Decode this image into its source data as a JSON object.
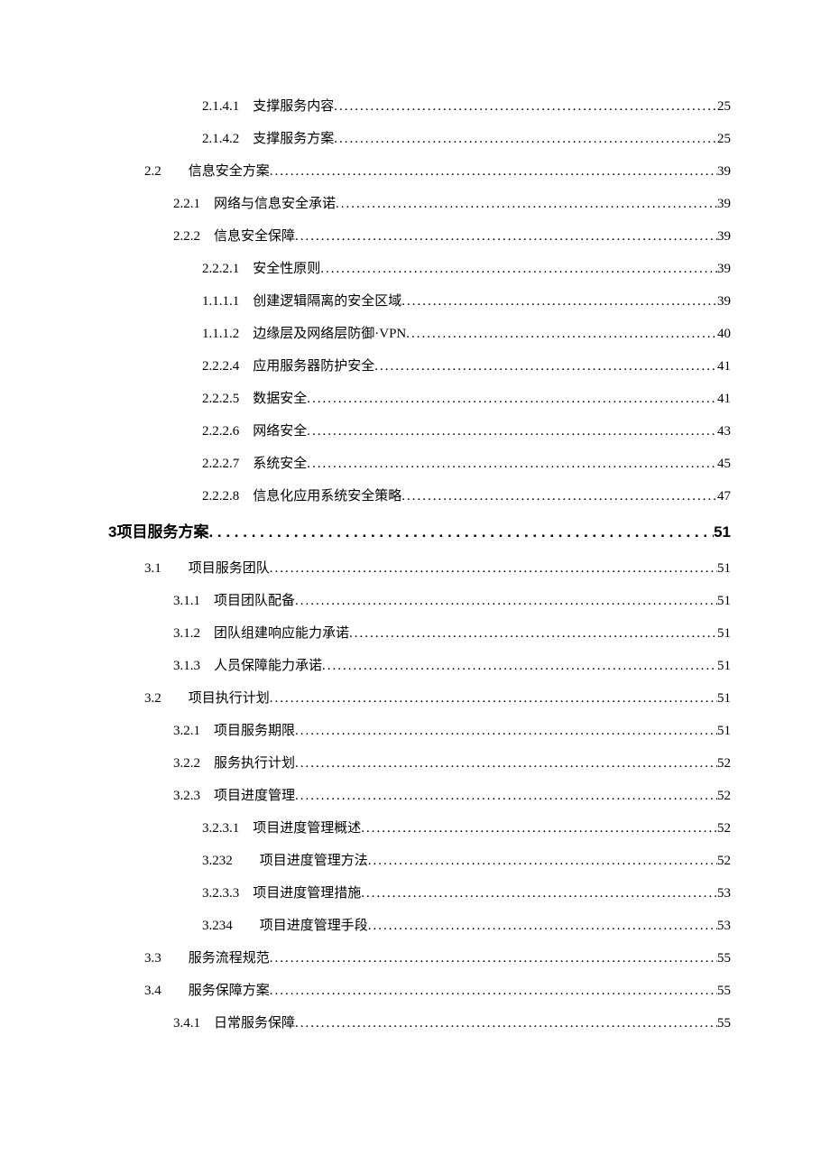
{
  "toc": [
    {
      "indent": 3,
      "num": "2.1.4.1",
      "gap": "　",
      "title": "支撑服务内容",
      "page": "25",
      "heading": false
    },
    {
      "indent": 3,
      "num": "2.1.4.2",
      "gap": "　",
      "title": "支撑服务方案",
      "page": "25",
      "heading": false
    },
    {
      "indent": 1,
      "num": "2.2",
      "gap": "　　",
      "title": "信息安全方案",
      "page": "39",
      "heading": false
    },
    {
      "indent": 2,
      "num": "2.2.1",
      "gap": "　",
      "title": "网络与信息安全承诺",
      "page": "39",
      "heading": false
    },
    {
      "indent": 2,
      "num": "2.2.2",
      "gap": "　",
      "title": "信息安全保障",
      "page": "39",
      "heading": false
    },
    {
      "indent": 3,
      "num": "2.2.2.1",
      "gap": "　",
      "title": "安全性原则",
      "page": "39",
      "heading": false
    },
    {
      "indent": 3,
      "num": "1.1.1.1",
      "gap": "　",
      "title": "创建逻辑隔离的安全区域",
      "page": "39",
      "heading": false
    },
    {
      "indent": 3,
      "num": "1.1.1.2",
      "gap": "　",
      "title": "边缘层及网络层防御·VPN",
      "page": "40",
      "heading": false
    },
    {
      "indent": 3,
      "num": "2.2.2.4",
      "gap": "　",
      "title": "应用服务器防护安全",
      "page": "41",
      "heading": false
    },
    {
      "indent": 3,
      "num": "2.2.2.5",
      "gap": "　",
      "title": "数据安全",
      "page": "41",
      "heading": false
    },
    {
      "indent": 3,
      "num": "2.2.2.6",
      "gap": "　",
      "title": "网络安全",
      "page": "43",
      "heading": false
    },
    {
      "indent": 3,
      "num": "2.2.2.7",
      "gap": "　",
      "title": "系统安全",
      "page": "45",
      "heading": false
    },
    {
      "indent": 3,
      "num": "2.2.2.8",
      "gap": "　",
      "title": "信息化应用系统安全策略",
      "page": "47",
      "heading": false
    },
    {
      "indent": 0,
      "num": "3",
      "gap": "",
      "title": "项目服务方案",
      "page": "51",
      "heading": true
    },
    {
      "indent": 1,
      "num": "3.1",
      "gap": "　　",
      "title": "项目服务团队",
      "page": "51",
      "heading": false
    },
    {
      "indent": 2,
      "num": "3.1.1",
      "gap": "　",
      "title": "项目团队配备",
      "page": "51",
      "heading": false
    },
    {
      "indent": 2,
      "num": "3.1.2",
      "gap": "　",
      "title": "团队组建响应能力承诺",
      "page": "51",
      "heading": false
    },
    {
      "indent": 2,
      "num": "3.1.3",
      "gap": "　",
      "title": "人员保障能力承诺",
      "page": "51",
      "heading": false
    },
    {
      "indent": 1,
      "num": "3.2",
      "gap": "　　",
      "title": "项目执行计划",
      "page": "51",
      "heading": false
    },
    {
      "indent": 2,
      "num": "3.2.1",
      "gap": "　",
      "title": "项目服务期限",
      "page": "51",
      "heading": false
    },
    {
      "indent": 2,
      "num": "3.2.2",
      "gap": "　",
      "title": "服务执行计划",
      "page": "52",
      "heading": false
    },
    {
      "indent": 2,
      "num": "3.2.3",
      "gap": "　",
      "title": "项目进度管理",
      "page": "52",
      "heading": false
    },
    {
      "indent": 3,
      "num": "3.2.3.1",
      "gap": "　",
      "title": "项目进度管理概述",
      "page": "52",
      "heading": false
    },
    {
      "indent": 3,
      "num": "3.232",
      "gap": "　　",
      "title": "项目进度管理方法",
      "page": "52",
      "heading": false
    },
    {
      "indent": 3,
      "num": "3.2.3.3",
      "gap": "　",
      "title": "项目进度管理措施",
      "page": "53",
      "heading": false
    },
    {
      "indent": 3,
      "num": "3.234",
      "gap": "　　",
      "title": "项目进度管理手段",
      "page": "53",
      "heading": false
    },
    {
      "indent": 1,
      "num": "3.3",
      "gap": "　　",
      "title": "服务流程规范",
      "page": "55",
      "heading": false
    },
    {
      "indent": 1,
      "num": "3.4",
      "gap": "　　",
      "title": "服务保障方案",
      "page": "55",
      "heading": false
    },
    {
      "indent": 2,
      "num": "3.4.1",
      "gap": "　",
      "title": "日常服务保障",
      "page": "55",
      "heading": false
    }
  ]
}
